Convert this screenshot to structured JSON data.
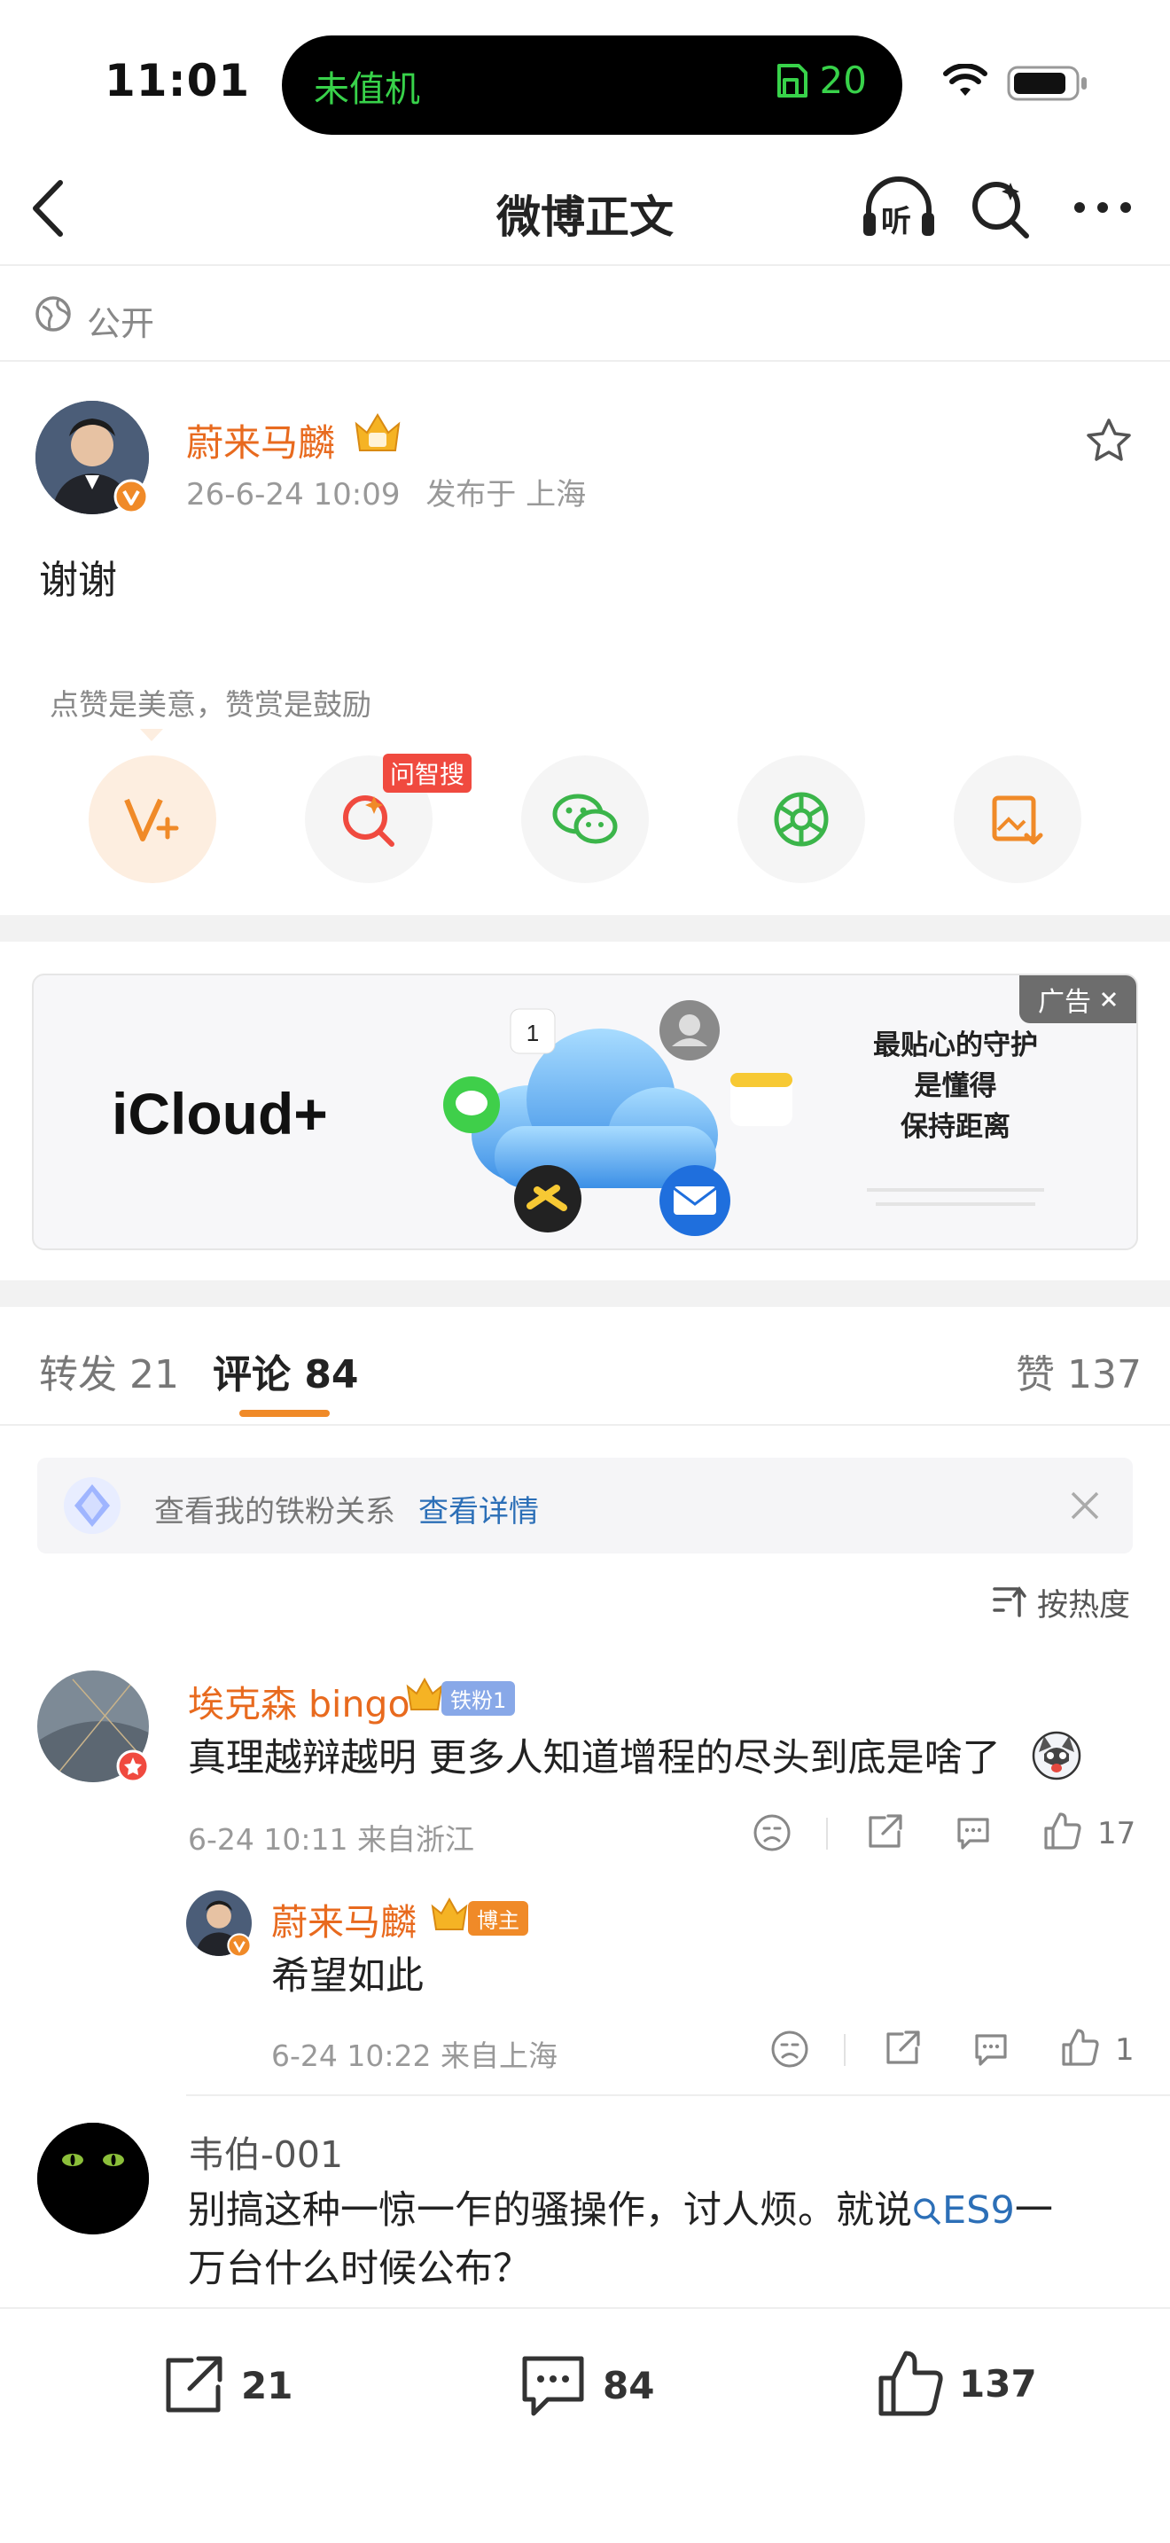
{
  "status_bar": {
    "time": "11:01",
    "island_left": "未值机",
    "island_right": "20"
  },
  "nav": {
    "title": "微博正文",
    "listen_icon_text": "听"
  },
  "visibility": {
    "label": "公开"
  },
  "post": {
    "author": "蔚来马麟",
    "date": "26-6-24 10:09",
    "location": "发布于 上海",
    "text": "谢谢",
    "reward_hint": "点赞是美意，赞赏是鼓励",
    "search_badge": "问智搜"
  },
  "ad": {
    "brand": "iCloud+",
    "slogan_line1": "最贴心的守护",
    "slogan_line2": "是懂得",
    "slogan_line3": "保持距离",
    "badge": "广告"
  },
  "tabs": {
    "repost": "转发 21",
    "comment": "评论 84",
    "like": "赞 137"
  },
  "fan_banner": {
    "text": "查看我的铁粉关系",
    "link": "查看详情"
  },
  "sort": {
    "label": "按热度"
  },
  "comments": [
    {
      "name": "埃克森 bingo",
      "badge": "铁粉1",
      "text": "真理越辩越明 更多人知道增程的尽头到底是啥了",
      "meta": "6-24 10:11  来自浙江",
      "likes": "17"
    },
    {
      "name": "蔚来马麟",
      "badge": "博主",
      "text": "希望如此",
      "meta": "6-24 10:22  来自上海",
      "likes": "1"
    },
    {
      "name": "韦伯-001",
      "text_line1": "别搞这种一惊一乍的骚操作，讨人烦。就说",
      "topic": "ES9",
      "text_line1_end": "一",
      "text_line2": "万台什么时候公布？"
    }
  ],
  "bottom_bar": {
    "repost_count": "21",
    "comment_count": "84",
    "like_count": "137"
  },
  "colors": {
    "accent_orange": "#e86a1e",
    "link_blue": "#2c6fb7",
    "island_green": "#38d24a"
  }
}
